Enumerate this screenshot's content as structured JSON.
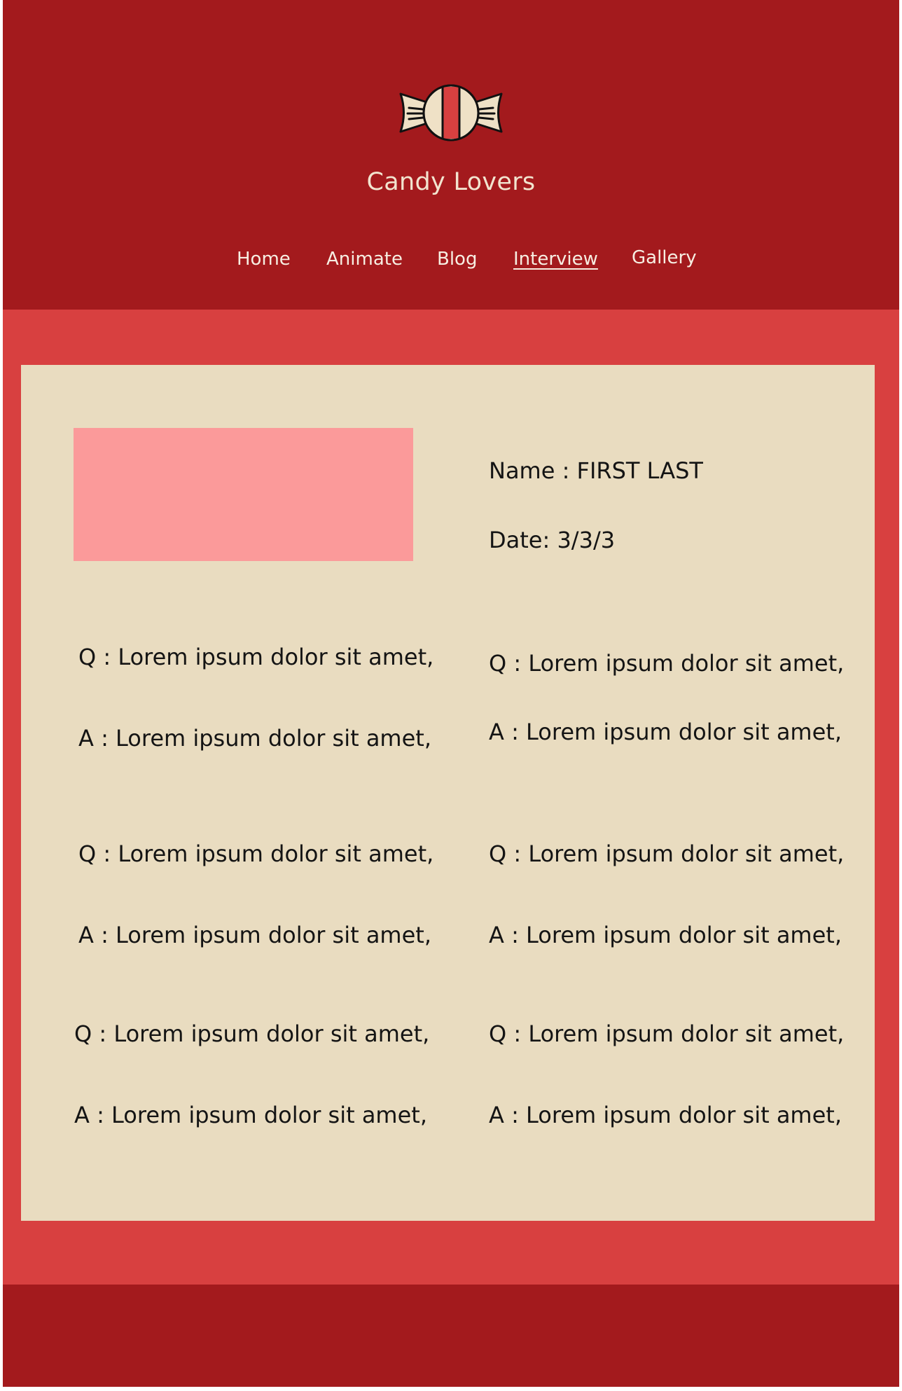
{
  "site": {
    "title": "Candy Lovers",
    "logo_icon": "candy-icon",
    "colors": {
      "header": "#a31a1d",
      "band": "#d84040",
      "card": "#e9dcc0",
      "photo_placeholder": "#fb9a9a",
      "title_text": "#f2e4cf"
    }
  },
  "nav": {
    "items": [
      {
        "label": "Home"
      },
      {
        "label": "Animate"
      },
      {
        "label": "Blog"
      },
      {
        "label": "Interview",
        "active": true
      },
      {
        "label": "Gallery"
      }
    ]
  },
  "interview": {
    "name_line": "Name : FIRST LAST",
    "date_line": "Date:  3/3/3",
    "qa": [
      {
        "q": "Q : Lorem ipsum dolor sit amet,",
        "a": "A : Lorem ipsum dolor sit amet,"
      },
      {
        "q": "Q : Lorem ipsum dolor sit amet,",
        "a": "A : Lorem ipsum dolor sit amet,"
      },
      {
        "q": "Q : Lorem ipsum dolor sit amet,",
        "a": "A : Lorem ipsum dolor sit amet,"
      },
      {
        "q": "Q : Lorem ipsum dolor sit amet,",
        "a": "A : Lorem ipsum dolor sit amet,"
      },
      {
        "q": "Q : Lorem ipsum dolor sit amet,",
        "a": "A : Lorem ipsum dolor sit amet,"
      },
      {
        "q": "Q : Lorem ipsum dolor sit amet,",
        "a": "A : Lorem ipsum dolor sit amet,"
      }
    ]
  }
}
